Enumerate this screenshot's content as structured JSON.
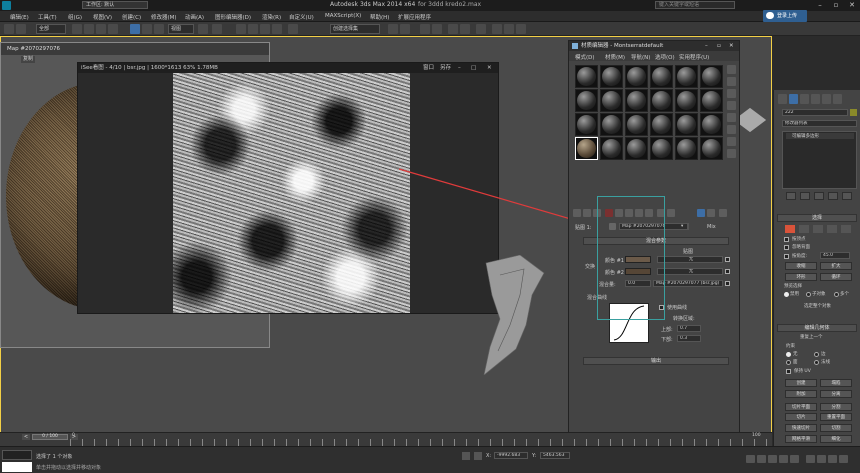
{
  "window": {
    "title": "Autodesk 3ds Max  2014 x64",
    "file_title": "for 3ddd kredo2.max",
    "workspace": "工作区: 默认",
    "search_placeholder": "键入关键字或短语",
    "sign_in": "登录上传"
  },
  "menus": [
    "编辑(E)",
    "工具(T)",
    "组(G)",
    "视图(V)",
    "创建(C)",
    "修改器(M)",
    "动画(A)",
    "图形编辑器(D)",
    "渲染(R)",
    "自定义(U)",
    "MAXScript(X)",
    "帮助(H)",
    "扩展应用程序"
  ],
  "toolbar": {
    "selection_filter": "全部",
    "view_dropdown": "视图",
    "named_selection": "创建选择集",
    "layer_buttons": [
      "切换",
      "柔化"
    ]
  },
  "left_viewport": {
    "label": "Map #2070297076",
    "sub_label": "复制"
  },
  "image_viewer": {
    "title": "iSee看图 - 4/10 | bsr.jpg | 1600*1613 63% 1.78MB",
    "actions": [
      "窗口",
      "另存",
      "全屏"
    ]
  },
  "material_editor": {
    "title": "材质编辑器 - Montserratdefault",
    "menus": [
      "模式(D)",
      "材质(M)",
      "导航(N)",
      "选项(O)",
      "实用程序(U)"
    ],
    "map_label": "贴图 1:",
    "map_name": "Map #2070297076",
    "map_type": "Mix",
    "mix_rollout": "混合参数",
    "maps_header": "贴图",
    "color1_label": "颜色 #1",
    "color1_map": "无",
    "color2_label": "颜色 #2",
    "color2_map": "无",
    "mix_amount_label": "混合量:",
    "mix_amount_value": "0.0",
    "mix_amount_map": "Map #2070297077 (bsr.jpg)",
    "swap_label": "交换",
    "mix_curve_label": "混合曲线",
    "use_curve_label": "使用曲线",
    "transition_label": "转换区域:",
    "upper_label": "上部:",
    "upper_value": "0.7",
    "lower_label": "下部:",
    "lower_value": "0.3",
    "output_rollout": "输出",
    "color1_hex": "#6b5a49",
    "color2_hex": "#564636"
  },
  "command_panel": {
    "object_name": "222",
    "modifier_list": "修改器列表",
    "stack_item": "可编辑多边形",
    "selection_header": "选择",
    "by_vertex": "按顶点",
    "ignore_backface": "忽略背面",
    "by_angle": "按角度:",
    "angle_value": "45.0",
    "shrink": "收缩",
    "grow": "扩大",
    "ring": "环形",
    "loop": "循环",
    "preview_header": "预览选择",
    "preview_options": [
      "禁用",
      "子对象",
      "多个"
    ],
    "selected_count": "选定整个对象",
    "edit_geometry_header": "编辑几何体",
    "repeat_last": "重复上一个",
    "constraints_header": "约束",
    "constraint_options": [
      "无",
      "边",
      "面",
      "法线"
    ],
    "preserve_uv": "保持 UV",
    "create": "创建",
    "collapse": "塌陷",
    "attach": "附加",
    "detach": "分离",
    "slice_plane": "切片平面",
    "split": "分割",
    "slice": "切片",
    "reset_plane": "重置平面",
    "quickslice": "快速切片",
    "cut": "切割",
    "mesh_smooth": "网格平滑",
    "tessellate": "细化"
  },
  "timeline": {
    "frame_readout": "0 / 100",
    "tick_start": "0",
    "tick_end": "100"
  },
  "status": {
    "line1": "选择了 1 个对象",
    "line2": "单击并拖动以选择并移动对象",
    "x_value": "-9992.683",
    "y_value": "5463.563",
    "welcome": "欢迎使用 MAXScript。"
  },
  "colors": {
    "accent": "#f3d046",
    "arrow": "#e03b3b",
    "sign_in_bg": "#2f5f91"
  }
}
